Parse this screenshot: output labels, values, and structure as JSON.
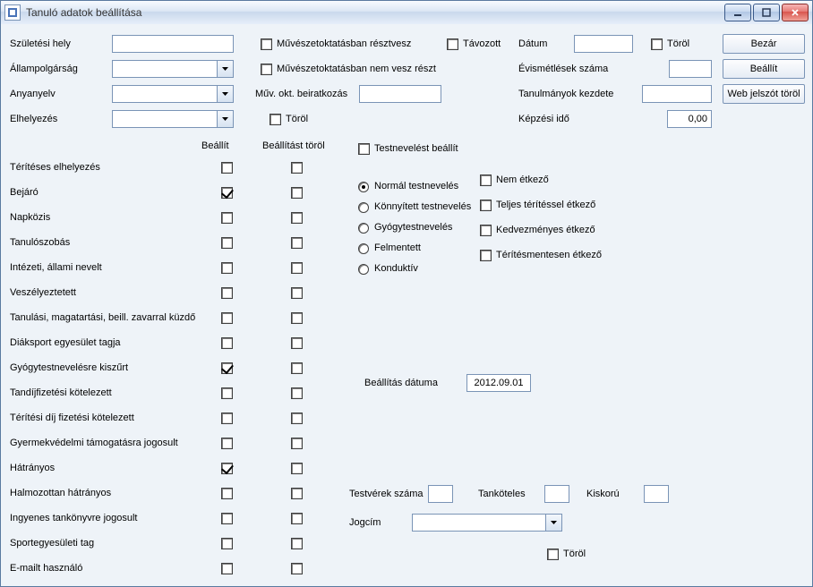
{
  "window": {
    "title": "Tanuló adatok beállítása"
  },
  "top": {
    "szul_hely": "Születési hely",
    "allampolg": "Állampolgárság",
    "anyanyelv": "Anyanyelv",
    "elhelyezes": "Elhelyezés",
    "muvokt_resztvesz": "Művészetoktatásban résztvesz",
    "muvokt_nem": "Művészetoktatásban nem vesz részt",
    "tavozott": "Távozott",
    "muv_beir": "Műv. okt. beiratkozás",
    "torol1": "Töröl",
    "datum": "Dátum",
    "torol2": "Töröl",
    "evismet": "Évismétlések száma",
    "tan_kezd": "Tanulmányok kezdete",
    "kepz_ido": "Képzési idő",
    "kepz_ido_val": "0,00"
  },
  "buttons": {
    "bezar": "Bezár",
    "beallit": "Beállít",
    "webjelszo": "Web jelszót töröl"
  },
  "cols": {
    "beallit": "Beállít",
    "beallitast_torol": "Beállítást töröl"
  },
  "testnev": {
    "beallit": "Testnevelést beállít",
    "normal": "Normál testnevelés",
    "konnyitett": "Könnyített testnevelés",
    "gyogy": "Gyógytestnevelés",
    "felmentett": "Felmentett",
    "konduktiv": "Konduktív"
  },
  "etk": {
    "nem": "Nem étkező",
    "teljes": "Teljes térítéssel étkező",
    "kedv": "Kedvezményes étkező",
    "teritmentes": "Térítésmentesen étkező"
  },
  "rows": {
    "r1": "Térítéses elhelyezés",
    "r2": "Bejáró",
    "r3": "Napközis",
    "r4": "Tanulószobás",
    "r5": "Intézeti, állami nevelt",
    "r6": "Veszélyeztetett",
    "r7": "Tanulási, magatartási, beill. zavarral küzdő",
    "r8": "Diáksport egyesület tagja",
    "r9": "Gyógytestnevelésre kiszűrt",
    "r10": "Tandíjfizetési kötelezett",
    "r11": "Térítési díj fizetési kötelezett",
    "r12": "Gyermekvédelmi támogatásra jogosult",
    "r13": "Hátrányos",
    "r14": "Halmozottan hátrányos",
    "r15": "Ingyenes tankönyvre jogosult",
    "r16": "Sportegyesületi tag",
    "r17": "E-mailt használó"
  },
  "bsect": {
    "bdatum": "Beállítás dátuma",
    "bdatum_val": "2012.09.01",
    "testverek": "Testvérek száma",
    "tankot": "Tanköteles",
    "kiskoru": "Kiskorú",
    "jogcim": "Jogcím",
    "torol": "Töröl"
  }
}
